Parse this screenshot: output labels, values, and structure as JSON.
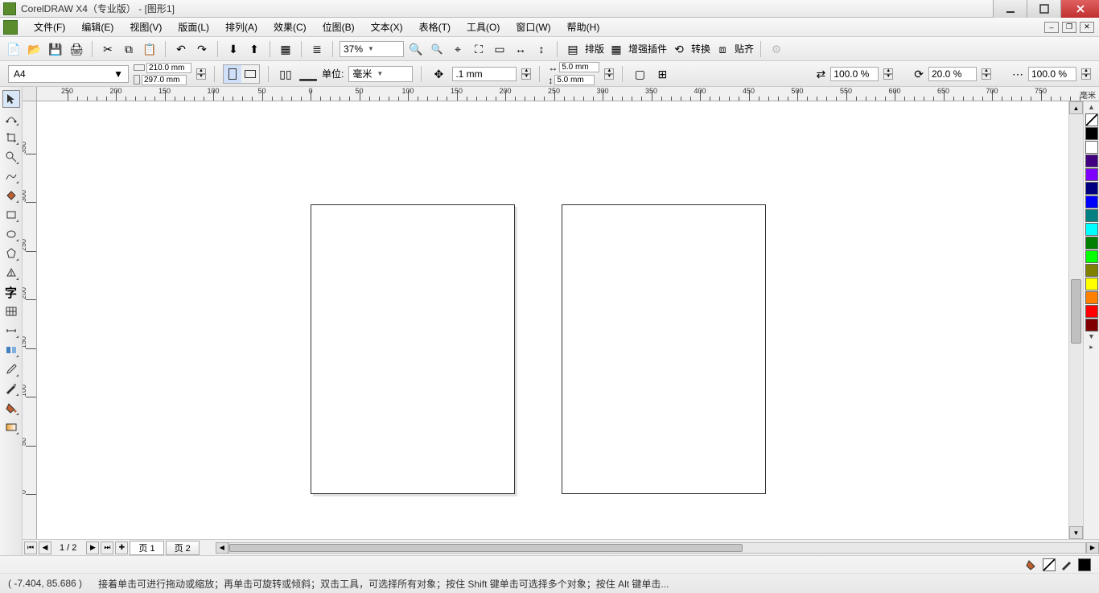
{
  "title": "CorelDRAW X4（专业版） - [图形1]",
  "menu": [
    "文件(F)",
    "编辑(E)",
    "视图(V)",
    "版面(L)",
    "排列(A)",
    "效果(C)",
    "位图(B)",
    "文本(X)",
    "表格(T)",
    "工具(O)",
    "窗口(W)",
    "帮助(H)"
  ],
  "toolbar1": {
    "zoom_value": "37%",
    "labels": {
      "layout": "排版",
      "enhance": "增强插件",
      "transform": "转换",
      "snap": "贴齐"
    }
  },
  "propbar": {
    "page_preset": "A4",
    "width": "210.0 mm",
    "height": "297.0 mm",
    "units_label": "单位:",
    "units_value": "毫米",
    "nudge": ".1 mm",
    "dup_x": "5.0 mm",
    "dup_y": "5.0 mm",
    "pct1": "100.0 %",
    "pct2": "20.0 %",
    "pct3": "100.0 %"
  },
  "ruler": {
    "unit_label": "毫米",
    "h_major": [
      -250,
      -200,
      -150,
      -100,
      -50,
      0,
      50,
      100,
      150,
      200,
      250,
      300,
      350,
      400,
      450,
      500,
      550,
      600,
      650,
      700,
      750
    ],
    "v_major": [
      350,
      300,
      250,
      200,
      150,
      100,
      50,
      0
    ]
  },
  "pages": {
    "counter": "1 / 2",
    "tabs": [
      "页 1",
      "页 2"
    ]
  },
  "palette": [
    "#000000",
    "#FFFFFF",
    "#400080",
    "#8000FF",
    "#000080",
    "#0000FF",
    "#008080",
    "#00FFFF",
    "#008000",
    "#00FF00",
    "#808000",
    "#FFFF00",
    "#FF8000",
    "#FF0000",
    "#800000",
    "#FF00FF",
    "#800080"
  ],
  "status": {
    "coords": "( -7.404, 85.686 )",
    "hint": "接着单击可进行拖动或缩放；再单击可旋转或倾斜；双击工具，可选择所有对象；按住 Shift 键单击可选择多个对象；按住 Alt 键单击..."
  }
}
